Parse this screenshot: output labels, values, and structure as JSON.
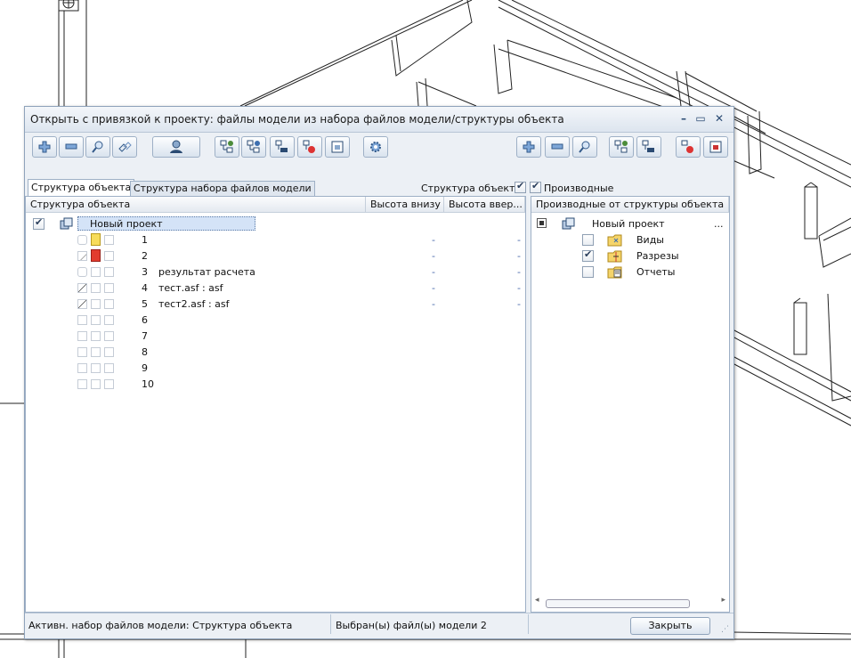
{
  "window": {
    "title": "Открыть с привязкой к проекту: файлы модели из набора файлов модели/структуры объекта",
    "minimize_icon": "minimize-icon",
    "maximize_icon": "maximize-icon",
    "close_icon": "close-icon"
  },
  "tabs": [
    {
      "label": "Структура объекта",
      "active": true
    },
    {
      "label": "Структура набора файлов модели",
      "active": false
    }
  ],
  "filters": {
    "structure_label": "Структура объекта",
    "structure_checked": true,
    "derived_label": "Производные",
    "derived_checked": true
  },
  "left_table": {
    "columns": [
      "Структура объекта",
      "Высота внизу",
      "Высота ввер..."
    ],
    "root_label": "Новый проект",
    "rows": [
      {
        "num": "1",
        "name": "",
        "h_bottom": "-",
        "h_top": "-"
      },
      {
        "num": "2",
        "name": "",
        "h_bottom": "-",
        "h_top": "-"
      },
      {
        "num": "3",
        "name": "результат расчета",
        "h_bottom": "-",
        "h_top": "-"
      },
      {
        "num": "4",
        "name": "тест.asf : asf",
        "h_bottom": "-",
        "h_top": "-"
      },
      {
        "num": "5",
        "name": "тест2.asf : asf",
        "h_bottom": "-",
        "h_top": "-"
      },
      {
        "num": "6",
        "name": "",
        "h_bottom": "",
        "h_top": ""
      },
      {
        "num": "7",
        "name": "",
        "h_bottom": "",
        "h_top": ""
      },
      {
        "num": "8",
        "name": "",
        "h_bottom": "",
        "h_top": ""
      },
      {
        "num": "9",
        "name": "",
        "h_bottom": "",
        "h_top": ""
      },
      {
        "num": "10",
        "name": "",
        "h_bottom": "",
        "h_top": ""
      }
    ]
  },
  "right_table": {
    "header": "Производные от структуры объекта",
    "root_label": "Новый проект",
    "root_more": "...",
    "items": [
      {
        "label": "Виды",
        "checked": false
      },
      {
        "label": "Разрезы",
        "checked": true
      },
      {
        "label": "Отчеты",
        "checked": false
      }
    ]
  },
  "status": {
    "active_set": "Активн. набор файлов модели: Структура объекта",
    "selected": "Выбран(ы) файл(ы) модели 2"
  },
  "buttons": {
    "close": "Закрыть"
  },
  "colors": {
    "accent": "#2b4b73",
    "selected_row": "#d4e3f7",
    "window_bg": "#ecf0f5"
  }
}
